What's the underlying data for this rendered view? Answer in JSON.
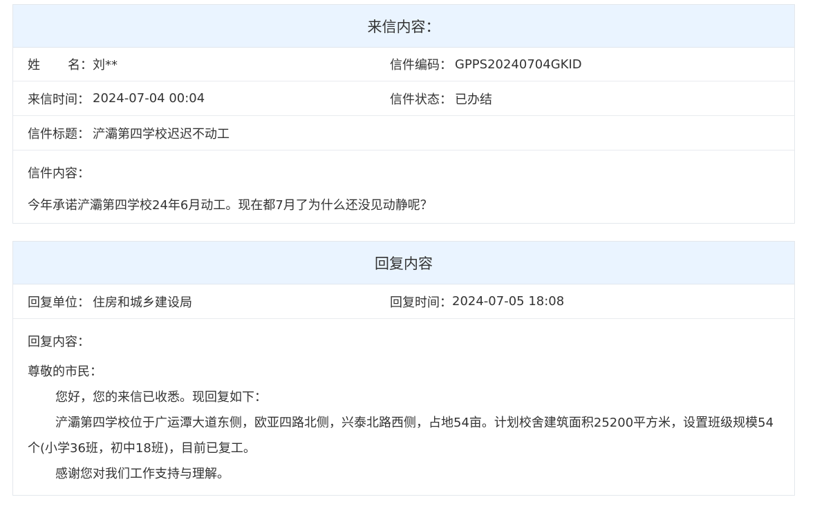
{
  "letter": {
    "title": "来信内容：",
    "name_label_1": "姓",
    "name_label_2": "名：",
    "name_value": "刘**",
    "code_label": "信件编码：",
    "code_value": "GPPS20240704GKID",
    "time_label": "来信时间：",
    "time_value": "2024-07-04 00:04",
    "status_label": "信件状态：",
    "status_value": "已办结",
    "subject_label": "信件标题：",
    "subject_value": "浐灞第四学校迟迟不动工",
    "content_label": "信件内容：",
    "content_text": "今年承诺浐灞第四学校24年6月动工。现在都7月了为什么还没见动静呢？"
  },
  "reply": {
    "title": "回复内容",
    "unit_label": "回复单位：",
    "unit_value": "住房和城乡建设局",
    "time_label": "回复时间：",
    "time_value": "2024-07-05 18:08",
    "content_label": "回复内容：",
    "greeting": "尊敬的市民：",
    "para1": "您好，您的来信已收悉。现回复如下：",
    "para2": "浐灞第四学校位于广运潭大道东侧，欧亚四路北侧，兴泰北路西侧，占地54亩。计划校舍建筑面积25200平方米，设置班级规模54个(小学36班，初中18班)，目前已复工。",
    "para3": "感谢您对我们工作支持与理解。"
  }
}
